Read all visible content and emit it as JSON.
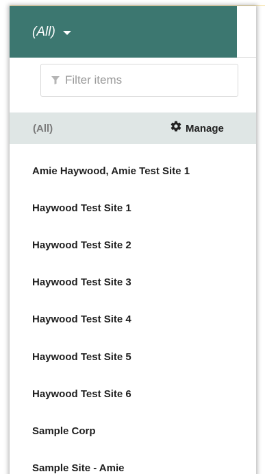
{
  "trigger": {
    "label": "(All)"
  },
  "filter": {
    "placeholder": "Filter items",
    "value": ""
  },
  "all_row": {
    "label": "(All)",
    "manage_label": "Manage"
  },
  "items": [
    "Amie Haywood, Amie Test Site 1",
    "Haywood Test Site 1",
    "Haywood Test Site 2",
    "Haywood Test Site 3",
    "Haywood Test Site 4",
    "Haywood Test Site 5",
    "Haywood Test Site 6",
    "Sample Corp",
    "Sample Site - Amie"
  ],
  "icons": {
    "trigger": "chevron-down-icon",
    "filter": "funnel-icon",
    "manage": "gear-icon"
  },
  "colors": {
    "header_bg": "#3c7770",
    "selected_row_bg": "#dfe6e5",
    "muted_text": "#7a7a7a",
    "item_text": "#1f1f1f"
  }
}
